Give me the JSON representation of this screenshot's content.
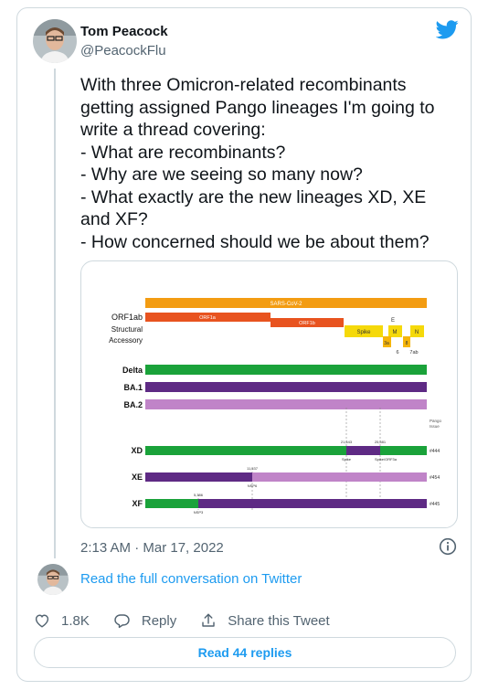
{
  "author": {
    "name": "Tom Peacock",
    "handle": "@PeacockFlu"
  },
  "tweet": {
    "lines": [
      "With three Omicron-related recombinants",
      "getting assigned Pango lineages I'm going to",
      "write a thread covering:",
      "- What are recombinants?",
      "- Why are we seeing so many now?",
      "- What exactly are the new lineages XD, XE",
      "and XF?",
      "- How concerned should we be about them?"
    ],
    "timestamp": "2:13 AM · Mar 17, 2022"
  },
  "figure": {
    "genome_label": "SARS-CoV-2",
    "row_labels": {
      "orf1ab": "ORF1ab",
      "structural": "Structural",
      "accessory": "Accessory"
    },
    "gene_labels": {
      "orf1a": "ORF1a",
      "orf1b": "ORF1b",
      "spike": "Spike",
      "e": "E",
      "m": "M",
      "n": "N",
      "g3a": "3a",
      "g6": "6",
      "g7ab": "7ab",
      "g8": "8"
    },
    "lineages": [
      "Delta",
      "BA.1",
      "BA.2"
    ],
    "pango_issue_label": "Pango\nIssue",
    "recombinants": [
      {
        "name": "XD",
        "issue": "#444",
        "bp1": "21,643",
        "bp2": "25,581",
        "annot1": "Spike",
        "annot2": "Spike/ORF3a"
      },
      {
        "name": "XE",
        "issue": "#454",
        "bp1": "11,537",
        "annot1": "NSP6"
      },
      {
        "name": "XF",
        "issue": "#445",
        "bp1": "5,386",
        "annot1": "NSP3"
      }
    ],
    "colors": {
      "genome": "#f39c12",
      "orf": "#e8531f",
      "structural": "#f5d90a",
      "delta": "#1aa23a",
      "ba1": "#5e2a84",
      "ba2": "#c084c8"
    }
  },
  "links": {
    "read_conversation": "Read the full conversation on Twitter"
  },
  "actions": {
    "likes": "1.8K",
    "reply": "Reply",
    "share": "Share this Tweet"
  },
  "replies_button": "Read 44 replies",
  "icons": {
    "brand": "twitter-bird-icon",
    "info": "info-icon",
    "like": "heart-icon",
    "reply": "reply-icon",
    "share": "share-icon"
  },
  "brand_color": "#1d9bf0"
}
